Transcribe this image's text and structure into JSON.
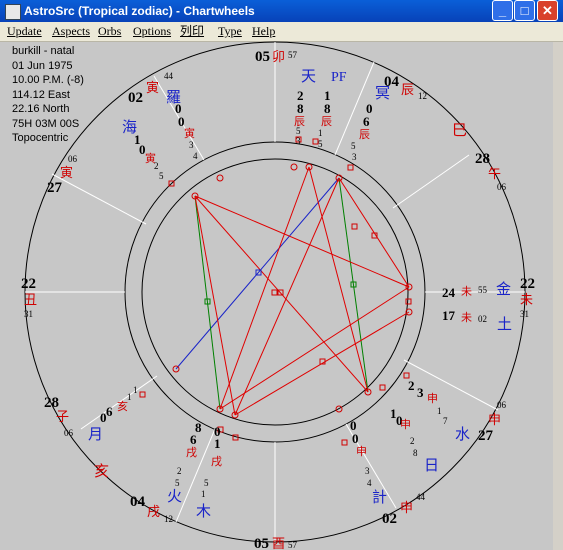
{
  "window": {
    "title": "AstroSrc (Tropical zodiac) - Chartwheels",
    "minimize_glyph": "_",
    "maximize_glyph": "□",
    "close_glyph": "✕"
  },
  "menu": [
    "Update",
    "Aspects",
    "Orbs",
    "Options",
    "列印",
    "Type",
    "Help"
  ],
  "info": [
    "burkill - natal",
    "01 Jun 1975",
    "10.00 P.M. (-8)",
    "114.12 East",
    "22.16 North",
    "75H  03M  00S",
    "Topocentric"
  ],
  "cusps": [
    {
      "id": "c1",
      "deg": "05",
      "sign": "卯",
      "min": "57"
    },
    {
      "id": "c2",
      "deg": "04",
      "sign": "辰",
      "min": "12"
    },
    {
      "id": "c3",
      "deg": "28",
      "sign": "午",
      "min": "06"
    },
    {
      "id": "c4",
      "deg": "22",
      "sign": "未",
      "min": "31"
    },
    {
      "id": "c5",
      "deg": "27",
      "sign": "申",
      "min": "06"
    },
    {
      "id": "c6",
      "deg": "02",
      "sign": "申",
      "min": "44"
    },
    {
      "id": "c7",
      "deg": "05",
      "sign": "酉",
      "min": "57"
    },
    {
      "id": "c8",
      "deg": "04",
      "sign": "戌",
      "min": "12"
    },
    {
      "id": "c9",
      "deg": "28",
      "sign": "子",
      "min": "06"
    },
    {
      "id": "c10",
      "deg": "22",
      "sign": "丑",
      "min": "31"
    },
    {
      "id": "c11",
      "deg": "27",
      "sign": "寅",
      "min": "06"
    },
    {
      "id": "c12",
      "deg": "02",
      "sign": "寅",
      "min": "44"
    }
  ],
  "signs": [
    "巳",
    "亥"
  ],
  "planets": [
    {
      "g": "天",
      "d1": "2",
      "d2": "8",
      "s": "辰",
      "m1": "5",
      "m2": "3"
    },
    {
      "g": "PF",
      "d1": "1",
      "d2": "8",
      "s": "辰",
      "m1": "1",
      "m2": "5"
    },
    {
      "g": "冥",
      "d1": "0",
      "d2": "6",
      "s": "辰",
      "m1": "5",
      "m2": "3"
    },
    {
      "g": "羅",
      "d1": "0",
      "d2": "0",
      "s": "寅",
      "m1": "3",
      "m2": "4"
    },
    {
      "g": "海",
      "d1": "1",
      "d2": "0",
      "s": "寅",
      "m1": "2",
      "m2": "5"
    },
    {
      "g": "金",
      "deg": "24",
      "s": "未",
      "min": "55"
    },
    {
      "g": "土",
      "deg": "17",
      "s": "未",
      "min": "02"
    },
    {
      "g": "水",
      "d1": "2",
      "d2": "3",
      "s": "申",
      "m1": "1",
      "m2": "7"
    },
    {
      "g": "日",
      "d1": "1",
      "d2": "0",
      "s": "申",
      "m1": "2",
      "m2": "8"
    },
    {
      "g": "計",
      "d1": "0",
      "d2": "0",
      "s": "申",
      "m1": "3",
      "m2": "4"
    },
    {
      "g": "火",
      "d1": "8",
      "d2": "6",
      "s": "戌",
      "m1": "2",
      "m2": "5"
    },
    {
      "g": "木",
      "d1": "0",
      "d2": "1",
      "s": "戌",
      "m1": "5",
      "m2": "1"
    },
    {
      "g": "月",
      "d1": "0",
      "d2": "6",
      "s": "亥",
      "m1": "1",
      "m2": "1"
    }
  ],
  "colors": {
    "house": "#d00000",
    "planet": "#1a24c8",
    "trine": "#008000",
    "opposition": "#1a24c8",
    "square": "#e00000"
  }
}
